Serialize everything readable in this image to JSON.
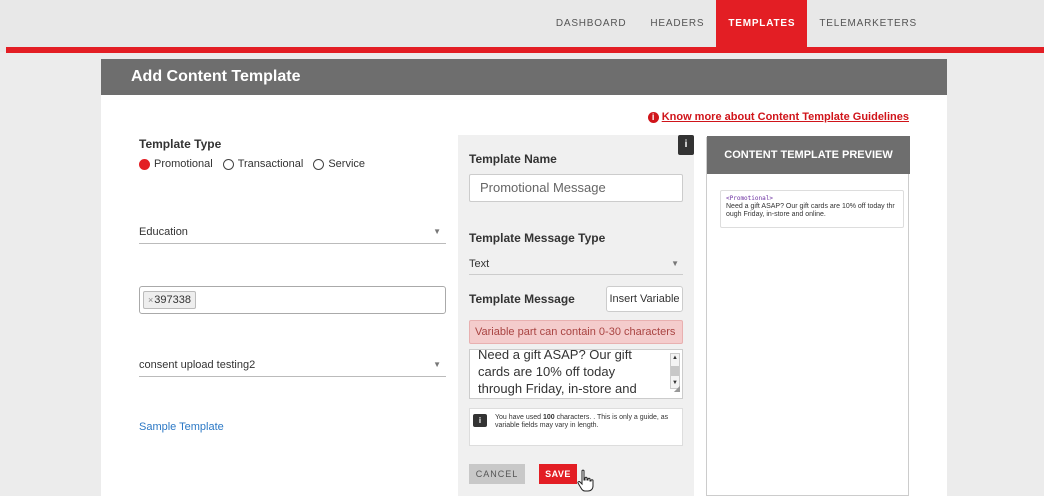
{
  "nav": {
    "items": [
      {
        "label": "DASHBOARD",
        "active": false
      },
      {
        "label": "HEADERS",
        "active": false
      },
      {
        "label": "TEMPLATES",
        "active": true
      },
      {
        "label": "TELEMARKETERS",
        "active": false
      }
    ]
  },
  "page": {
    "title": "Add Content Template",
    "guideline_icon": "info-circle-icon",
    "guideline_link": "Know more about Content Template Guidelines"
  },
  "left": {
    "template_type_label": "Template Type",
    "radios": [
      {
        "label": "Promotional",
        "checked": true
      },
      {
        "label": "Transactional",
        "checked": false
      },
      {
        "label": "Service",
        "checked": false
      }
    ],
    "category_value": "Education",
    "header_tag": "397338",
    "consent_value": "consent upload testing2",
    "sample_link": "Sample Template"
  },
  "middle": {
    "info_icon": "info-icon",
    "name_label": "Template Name",
    "name_value": "Promotional Message",
    "type_label": "Template Message Type",
    "type_value": "Text",
    "message_label": "Template Message",
    "insert_label": "Insert Variable",
    "alert": "Variable part can contain 0-30 characters",
    "message_value": "Need a gift ASAP? Our gift cards are 10% off today through Friday, in-store and online.",
    "char_info_prefix": "You have used ",
    "char_count": "100",
    "char_info_suffix": " characters. . This is only a guide, as variable fields may vary in length.",
    "cancel_label": "CANCEL",
    "save_label": "SAVE"
  },
  "preview": {
    "header": "CONTENT TEMPLATE PREVIEW",
    "tag": "<Promotional>",
    "message": "Need a gift ASAP? Our gift cards are 10% off today through Friday, in-store and online."
  },
  "colors": {
    "accent": "#e31e24",
    "header_gray": "#6e6e6e",
    "link_blue": "#2b78c5"
  }
}
